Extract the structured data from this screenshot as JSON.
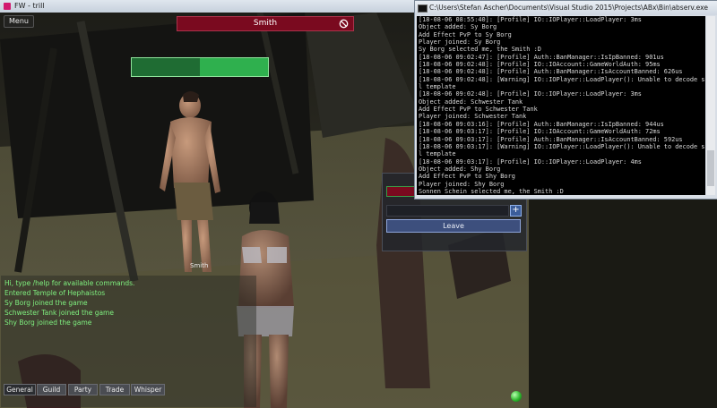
{
  "game": {
    "window_title": "FW - trill",
    "menu_label": "Menu",
    "target_name": "Smith",
    "target_health_fraction": 1.0,
    "smith_label": "Smith",
    "party": {
      "leave_label": "Leave",
      "add_label": "+"
    },
    "chat": {
      "lines": [
        "Hi, type /help for available commands.",
        "Entered Temple of Hephaistos",
        "Sy Borg joined the game",
        "Schwester Tank joined the game",
        "Shy Borg joined the game"
      ],
      "tabs": [
        {
          "label": "General"
        },
        {
          "label": "Guild"
        },
        {
          "label": "Party"
        },
        {
          "label": "Trade"
        },
        {
          "label": "Whisper"
        }
      ],
      "active_tab": "General"
    },
    "colors": {
      "chat_text": "#7ff07f",
      "target_bar": "#7a0a1f",
      "health": "#2fb04e"
    }
  },
  "console": {
    "window_title": "C:\\Users\\Stefan Ascher\\Documents\\Visual Studio 2015\\Projects\\ABx\\Bin\\abserv.exe",
    "lines": [
      "[18-08-06 08:55:40]: [Profile] IO::IOPlayer::LoadPlayer: 3ms",
      "Object added: Sy Borg",
      "Add Effect PvP to Sy Borg",
      "Player joined: Sy Borg",
      "Sy Borg selected me, the Smith :D",
      "[18-08-06 09:02:47]: [Profile] Auth::BanManager::IsIpBanned: 901us",
      "[18-08-06 09:02:48]: [Profile] IO::IOAccount::GameWorldAuth: 95ms",
      "[18-08-06 09:02:48]: [Profile] Auth::BanManager::IsAccountBanned: 626us",
      "[18-08-06 09:02:48]: [Warning] IO::IOPlayer::LoadPlayer(): Unable to decode skil",
      "l template",
      "[18-08-06 09:02:48]: [Profile] IO::IOPlayer::LoadPlayer: 3ms",
      "Object added: Schwester Tank",
      "Add Effect PvP to Schwester Tank",
      "Player joined: Schwester Tank",
      "[18-08-06 09:03:16]: [Profile] Auth::BanManager::IsIpBanned: 944us",
      "[18-08-06 09:03:17]: [Profile] IO::IOAccount::GameWorldAuth: 72ms",
      "[18-08-06 09:03:17]: [Profile] Auth::BanManager::IsAccountBanned: 592us",
      "[18-08-06 09:03:17]: [Warning] IO::IOPlayer::LoadPlayer(): Unable to decode skil",
      "l template",
      "[18-08-06 09:03:17]: [Profile] IO::IOPlayer::LoadPlayer: 4ms",
      "Object added: Shy Borg",
      "Add Effect PvP to Shy Borg",
      "Player joined: Shy Borg",
      "Sonnen Schein selected me, the Smith :D"
    ]
  }
}
